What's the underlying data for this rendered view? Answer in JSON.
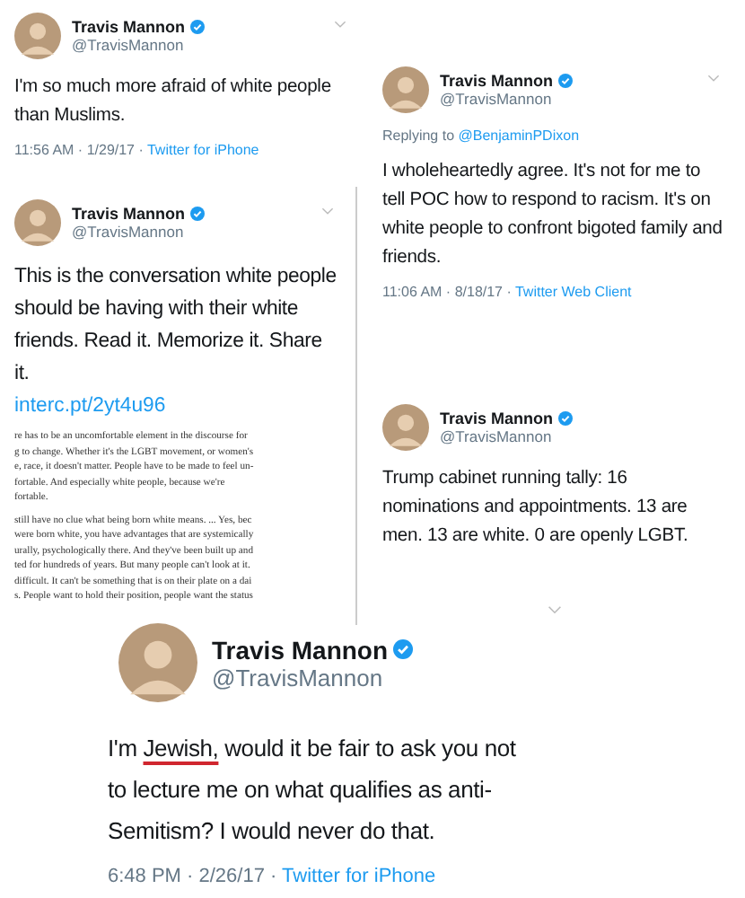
{
  "tweets": [
    {
      "name": "Travis Mannon",
      "handle": "@TravisMannon",
      "segments": [
        {
          "text": "I'm so much more afraid of white people than Muslims.",
          "underlined": false
        }
      ],
      "timestamp": "11:56 AM · 1/29/17 · ",
      "source": "Twitter for iPhone"
    },
    {
      "name": "Travis Mannon",
      "handle": "@TravisMannon",
      "replying_label": "Replying to ",
      "replying_to": "@BenjaminPDixon",
      "segments": [
        {
          "text": "I wholeheartedly agree. It's not for me to tell POC how to respond to racism. It's on white people to confront bigoted family and friends.",
          "underlined": false
        }
      ],
      "timestamp": "11:06 AM · 8/18/17 · ",
      "source": "Twitter Web Client"
    },
    {
      "name": "Travis Mannon",
      "handle": "@TravisMannon",
      "segments": [
        {
          "text": "This is the conversation white people should be having with their white friends. Read it. Memorize it. Share it.",
          "underlined": false
        }
      ],
      "link": "interc.pt/2yt4u96",
      "article_paragraphs": [
        [
          "re has to be an uncomfortable element in the discourse for",
          "g to change. Whether it's the LGBT movement, or women's",
          "e, race, it doesn't matter. People have to be made to feel un-",
          "fortable. And especially white people, because we're",
          "fortable."
        ],
        [
          "still have no clue what being born white means. ... Yes, bec",
          "were born white, you have advantages that are systemically",
          "urally, psychologically there. And they've been built up and",
          "ted for hundreds of years. But many people can't look at it.",
          "difficult. It can't be something that is on their plate on a dai",
          "s. People want to hold their position, people want the status"
        ]
      ]
    },
    {
      "name": "Travis Mannon",
      "handle": "@TravisMannon",
      "segments": [
        {
          "text": "Trump cabinet running tally: 16 nominations and appointments. 13 are men. 13 are white. 0 are openly LGBT.",
          "underlined": false
        }
      ]
    },
    {
      "name": "Travis Mannon",
      "handle": "@TravisMannon",
      "segments": [
        {
          "text": "I'm ",
          "underlined": false
        },
        {
          "text": "Jewish,",
          "underlined": true
        },
        {
          "text": " would it be fair to ask you not to lecture me on what qualifies as anti-Semitism? I  would never do that.",
          "underlined": false
        }
      ],
      "timestamp": "6:48 PM · 2/26/17 · ",
      "source": "Twitter for iPhone"
    }
  ]
}
